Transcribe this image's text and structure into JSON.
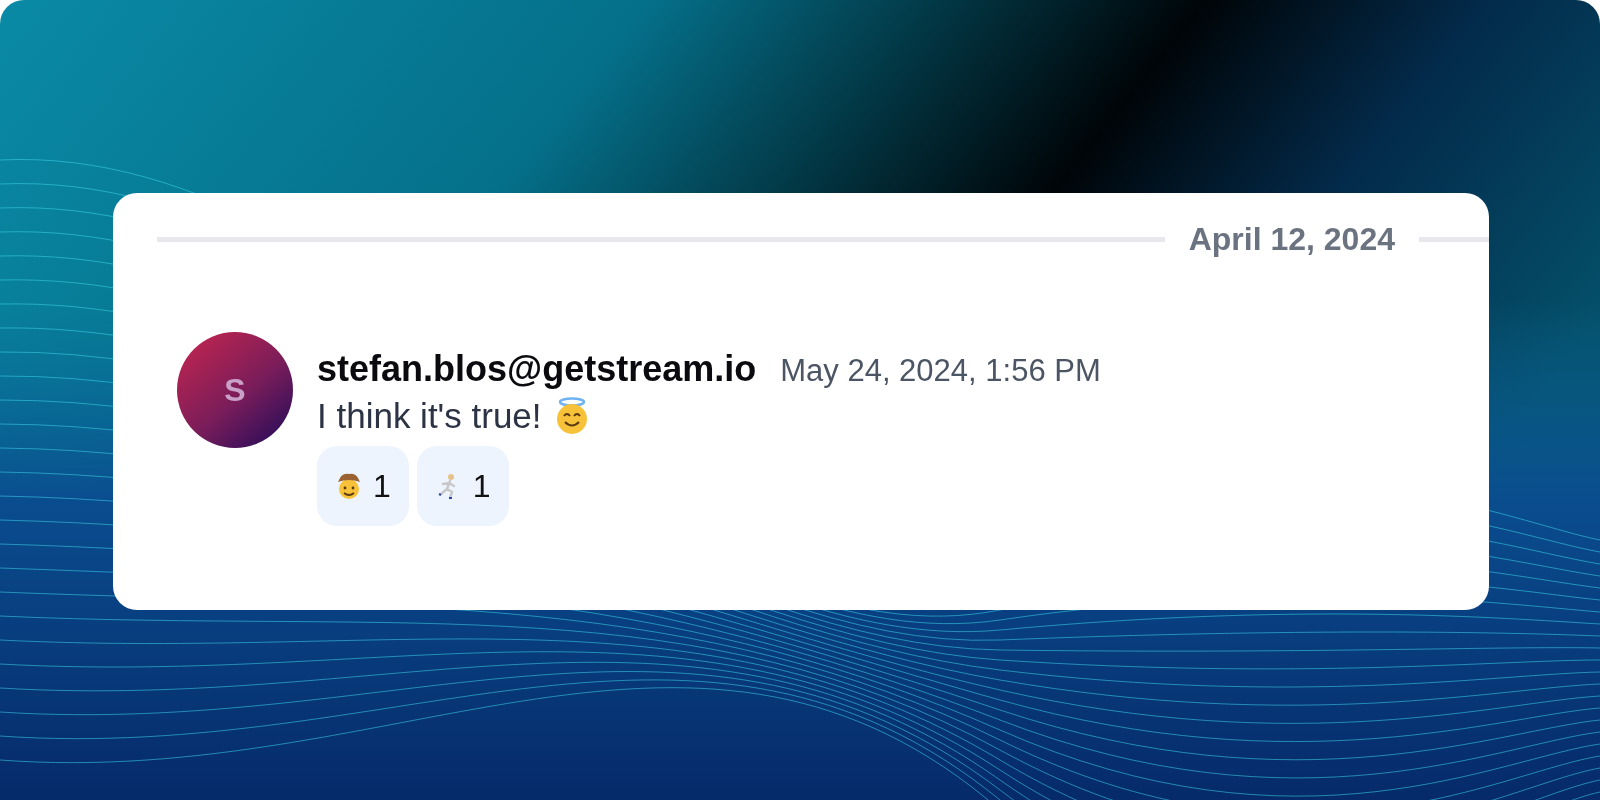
{
  "date_separator": "April 12, 2024",
  "message": {
    "avatar_initial": "S",
    "author": "stefan.blos@getstream.io",
    "timestamp": "May 24, 2024, 1:56 PM",
    "text": "I think it's true!",
    "reactions": [
      {
        "kind": "cowboy",
        "count": "1"
      },
      {
        "kind": "runner",
        "count": "1"
      }
    ]
  }
}
